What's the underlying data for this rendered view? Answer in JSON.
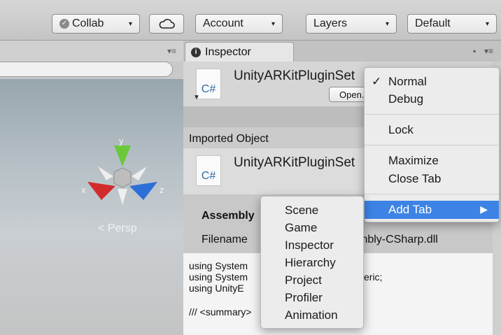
{
  "toolbar": {
    "collab": "Collab",
    "account": "Account",
    "layers": "Layers",
    "layout": "Default",
    "dropdown_arrow": "▾",
    "cloud_icon": "cloud-icon"
  },
  "scene": {
    "axis_x": "x",
    "axis_y": "y",
    "axis_z": "z",
    "persp": "Persp",
    "persp_marker": "<"
  },
  "inspector": {
    "tab_label": "Inspector",
    "file_title": "UnityARKitPluginSet",
    "file_icon_text": "C#",
    "open_button": "Open.",
    "imported_object": "Imported Object",
    "imported_title": "UnityARKitPluginSet",
    "assembly_label": "Assembly",
    "filename_label": "Filename",
    "filename_value": "mbly-CSharp.dll",
    "code_lines": [
      "using System",
      "using System",
      "using UnityE",
      "",
      "/// <summary>"
    ],
    "code_suffix": "eric;"
  },
  "menu": {
    "normal": "Normal",
    "debug": "Debug",
    "lock": "Lock",
    "maximize": "Maximize",
    "close_tab": "Close Tab",
    "add_tab": "Add Tab",
    "checkmark": "✓",
    "submenu_arrow": "▶"
  },
  "submenu": [
    "Scene",
    "Game",
    "Inspector",
    "Hierarchy",
    "Project",
    "Profiler",
    "Animation"
  ],
  "colors": {
    "highlight": "#3d83e5",
    "gizmo_x": "#d12b2b",
    "gizmo_y": "#6cc83a",
    "gizmo_z": "#2d6fd9"
  }
}
